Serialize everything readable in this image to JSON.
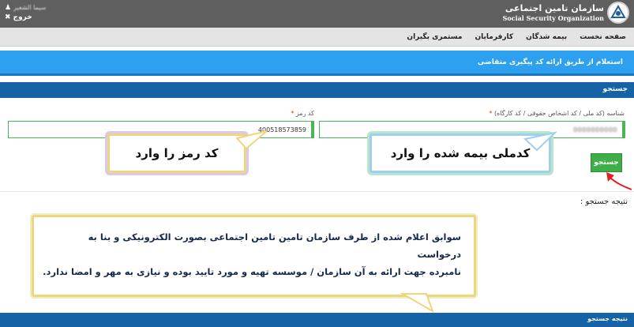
{
  "header": {
    "username": "سیما الشعیر",
    "logout_label": "خروج",
    "logo_title_fa": "سازمان تامین اجتماعی",
    "logo_title_en": "Social Security Organization"
  },
  "nav": {
    "items": [
      "صفحه نخست",
      "بیمه شدگان",
      "کارفرمایان",
      "مستمری بگیران"
    ]
  },
  "banner": {
    "text": "استعلام از طریق ارائه کد پیگیری متقاضی"
  },
  "search": {
    "heading": "جستجو",
    "id_label": "شناسه (کد ملی / کد اشخاص حقوقی / کد کارگاه)",
    "id_value": "0000000000",
    "password_label": "کد رمز",
    "password_value": "400518573859",
    "required_mark": "*",
    "button_label": "جستجو"
  },
  "callouts": {
    "password_hint": "کد رمز را وارد",
    "code_hint": "کدملی بیمه شده را وارد"
  },
  "result": {
    "label": "نتیجه جستجو :",
    "note_line1": "سوابق اعلام شده از طرف سازمان تامین تامین اجتماعی بصورت الکترونیکی و بنا به درخواست",
    "note_line2": "نامبرده جهت ارائه به آن سازمان / موسسه تهیه و مورد تایید بوده و نیازی به مهر و امضا ندارد.",
    "heading": "نتیجه جستجو"
  },
  "colors": {
    "header_bg": "#5f5f5f",
    "banner_bg": "#2da1f0",
    "panel_head_bg": "#1662a6",
    "accent_green": "#3fae49",
    "callout_yellow": "#f2d47a",
    "arrow_red": "#e02020"
  }
}
